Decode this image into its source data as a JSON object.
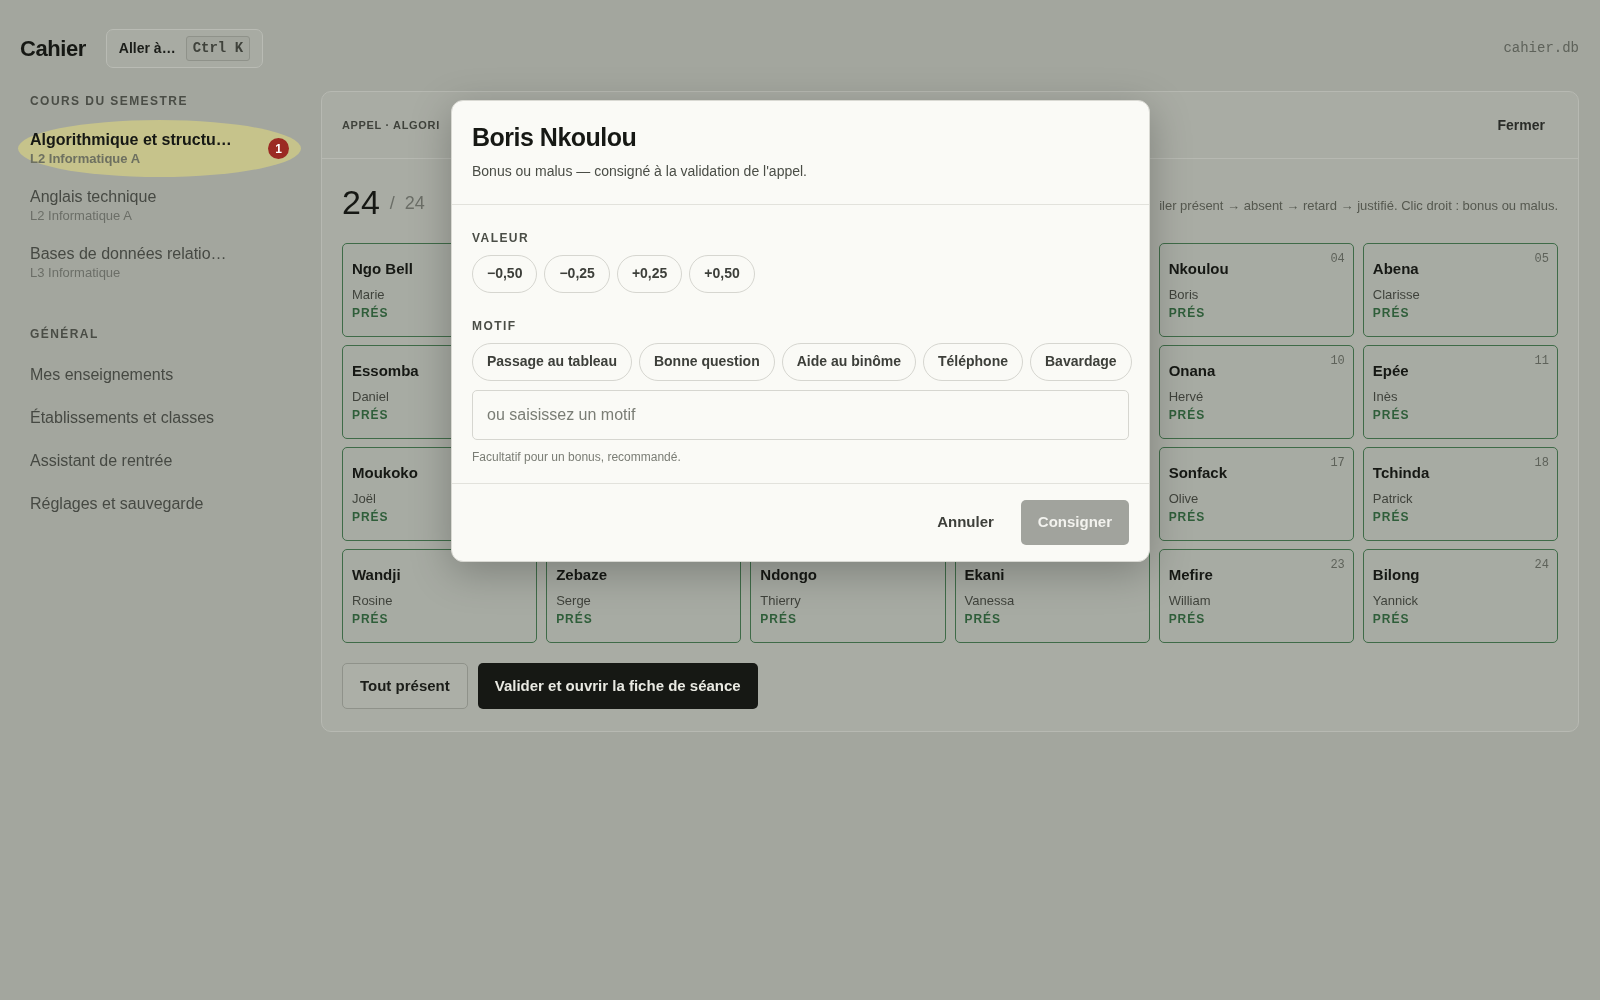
{
  "app": {
    "logo": "Cahier",
    "goto": {
      "label": "Aller à…",
      "shortcut": "Ctrl K"
    },
    "db_name": "cahier.db"
  },
  "sidebar": {
    "sections": [
      {
        "title": "COURS DU SEMESTRE",
        "items": [
          {
            "label": "Algorithmique et structu…",
            "sub": "L2 Informatique A",
            "selected": true,
            "badge": "1"
          },
          {
            "label": "Anglais technique",
            "sub": "L2 Informatique A",
            "selected": false
          },
          {
            "label": "Bases de données relatio…",
            "sub": "L3 Informatique",
            "selected": false
          }
        ]
      },
      {
        "title": "GÉNÉRAL",
        "items": [
          {
            "label": "Mes enseignements",
            "selected": false
          },
          {
            "label": "Établissements et classes",
            "selected": false
          },
          {
            "label": "Assistant de rentrée",
            "selected": false
          },
          {
            "label": "Réglages et sauvegarde",
            "selected": false
          }
        ]
      }
    ]
  },
  "panel": {
    "title": "APPEL · ALGORI",
    "close": "Fermer",
    "count": "24",
    "separator": "/",
    "total": "24",
    "hint": "iler présent → absent → retard → justifié. Clic droit : bonus ou malus.",
    "rows": [
      [
        {
          "surname": "Ngo Bell",
          "first_name": "Marie",
          "status": "PRÉS"
        },
        null,
        null,
        null,
        {
          "surname": "Nkoulou",
          "first_name": "Boris",
          "status": "PRÉS",
          "number": "04"
        },
        {
          "surname": "Abena",
          "first_name": "Clarisse",
          "status": "PRÉS",
          "number": "05"
        }
      ],
      [
        {
          "surname": "Essomba",
          "first_name": "Daniel",
          "status": "PRÉS"
        },
        null,
        null,
        null,
        {
          "surname": "Onana",
          "first_name": "Hervé",
          "status": "PRÉS",
          "number": "10"
        },
        {
          "surname": "Epée",
          "first_name": "Inès",
          "status": "PRÉS",
          "number": "11"
        }
      ],
      [
        {
          "surname": "Moukoko",
          "first_name": "Joël",
          "status": "PRÉS"
        },
        null,
        null,
        null,
        {
          "surname": "Sonfack",
          "first_name": "Olive",
          "status": "PRÉS",
          "number": "17"
        },
        {
          "surname": "Tchinda",
          "first_name": "Patrick",
          "status": "PRÉS",
          "number": "18"
        }
      ],
      [
        {
          "surname": "Wandji",
          "first_name": "Rosine",
          "status": "PRÉS"
        },
        {
          "surname": "Zebaze",
          "first_name": "Serge",
          "status": "PRÉS"
        },
        {
          "surname": "Ndongo",
          "first_name": "Thierry",
          "status": "PRÉS"
        },
        {
          "surname": "Ekani",
          "first_name": "Vanessa",
          "status": "PRÉS"
        },
        {
          "surname": "Mefire",
          "first_name": "William",
          "status": "PRÉS",
          "number": "23"
        },
        {
          "surname": "Bilong",
          "first_name": "Yannick",
          "status": "PRÉS",
          "number": "24"
        }
      ]
    ],
    "actions": [
      {
        "label": "Tout présent",
        "kind": "outline"
      },
      {
        "label": "Valider et ouvrir la fiche de séance",
        "kind": "primary"
      }
    ]
  },
  "dialog": {
    "title": "Boris Nkoulou",
    "subtitle": "Bonus ou malus — consigné à la validation de l'appel.",
    "value_label": "VALEUR",
    "values": [
      {
        "label": "−0,50",
        "selected": false
      },
      {
        "label": "−0,25",
        "selected": false
      },
      {
        "label": "+0,25",
        "selected": false
      },
      {
        "label": "+0,50",
        "selected": false
      }
    ],
    "motif_label": "MOTIF",
    "motifs": [
      {
        "label": "Passage au tableau",
        "selected": false
      },
      {
        "label": "Bonne question",
        "selected": false
      },
      {
        "label": "Aide au binôme",
        "selected": false
      },
      {
        "label": "Téléphone",
        "selected": false
      },
      {
        "label": "Bavardage",
        "selected": false
      }
    ],
    "motif_field": {
      "placeholder": "ou saisissez un motif"
    },
    "help": "Facultatif pour un bonus, recommandé.",
    "cancel": "Annuler",
    "submit": {
      "label": "Consigner",
      "disabled": true
    }
  }
}
